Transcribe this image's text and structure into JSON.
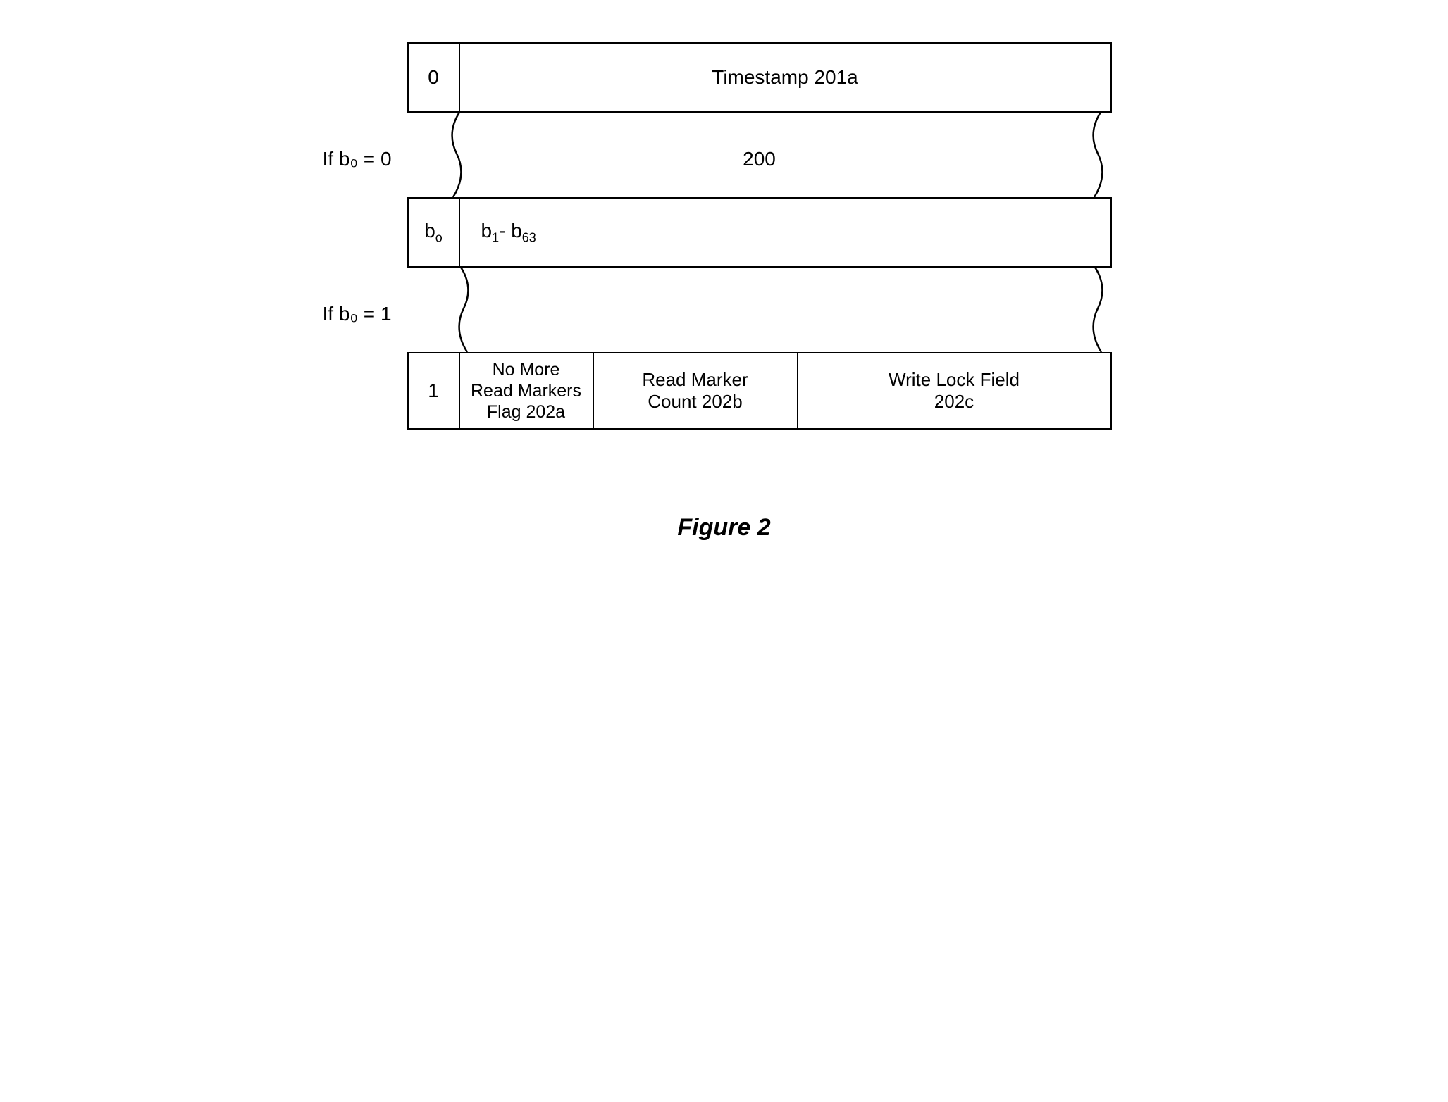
{
  "row1": {
    "bit": "0",
    "field": "Timestamp 201a"
  },
  "condition0": "If b₀ = 0",
  "ref200": "200",
  "row2": {
    "bit_label": "b",
    "bit_sub": "o",
    "range_prefix": "b",
    "range_sub1": "1",
    "range_mid": "-  b",
    "range_sub2": "63"
  },
  "condition1": "If b₀ = 1",
  "row3": {
    "bit": "1",
    "field1_line1": "No More",
    "field1_line2": "Read Markers",
    "field1_line3": "Flag 202a",
    "field2_line1": "Read Marker",
    "field2_line2": "Count 202b",
    "field3_line1": "Write Lock Field",
    "field3_line2": "202c"
  },
  "caption": "Figure 2"
}
